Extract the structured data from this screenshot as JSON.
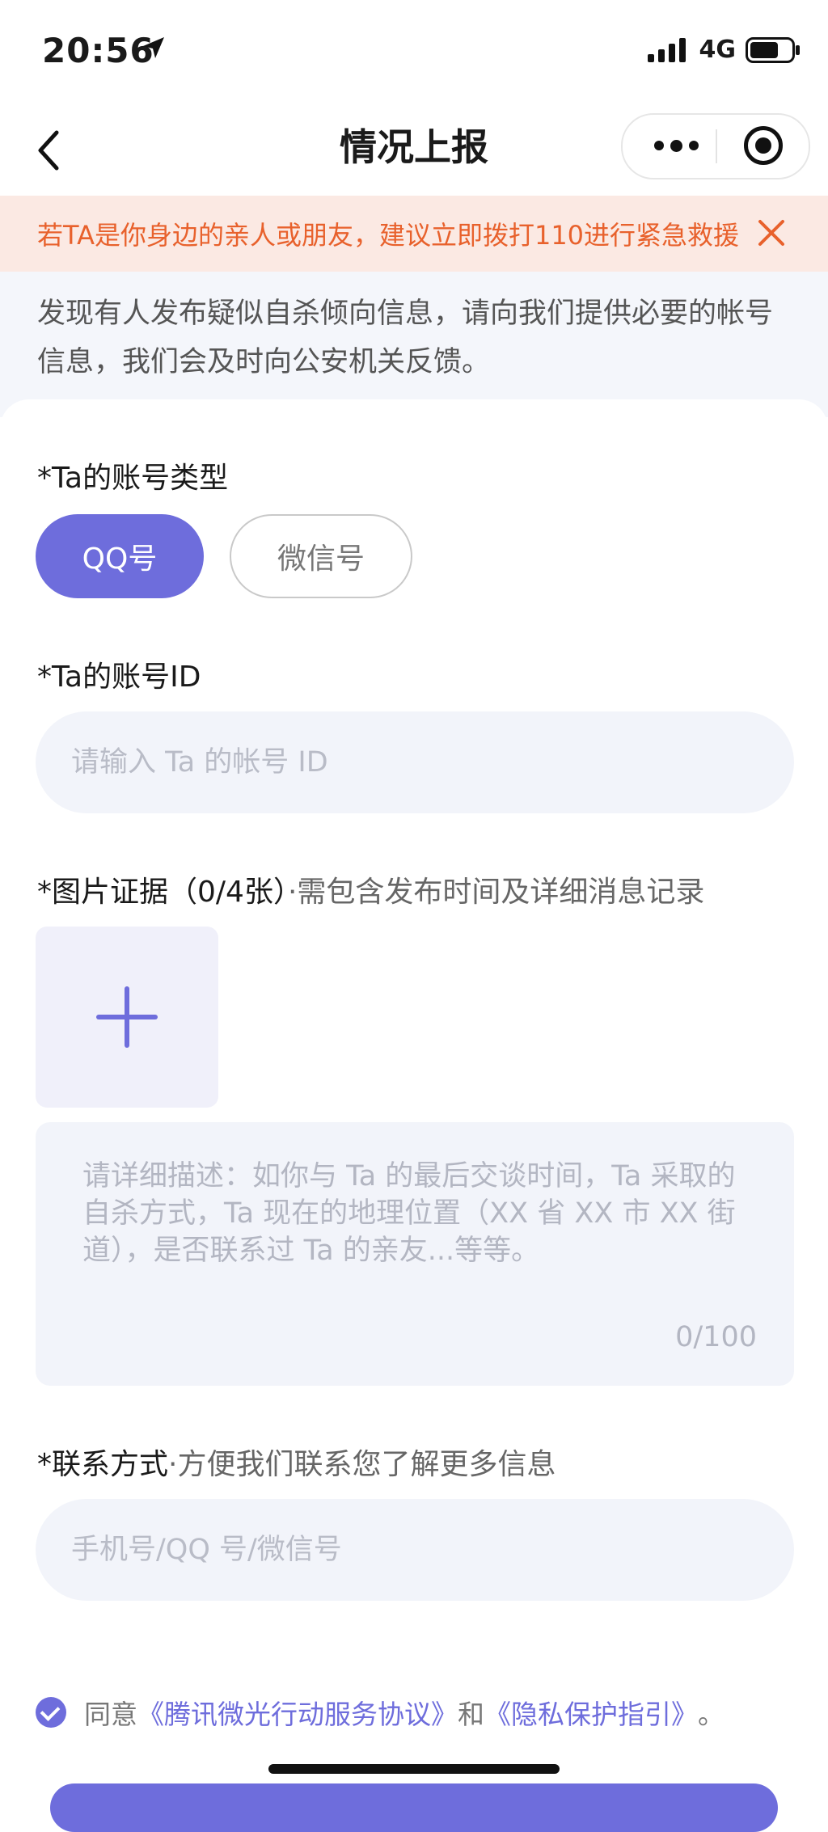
{
  "status_bar": {
    "time": "20:56",
    "network": "4G"
  },
  "nav": {
    "title": "情况上报"
  },
  "warning": {
    "text": "若TA是你身边的亲人或朋友，建议立即拨打110进行紧急救援"
  },
  "intro": {
    "text": "发现有人发布疑似自杀倾向信息，请向我们提供必要的帐号信息，我们会及时向公安机关反馈。"
  },
  "form": {
    "account_type_label": "*Ta的账号类型",
    "account_types": [
      "QQ号",
      "微信号"
    ],
    "selected_account_type": "QQ号",
    "account_id_label": "*Ta的账号ID",
    "account_id_placeholder": "请输入 Ta 的帐号 ID",
    "account_id_value": "",
    "evidence_label": "*图片证据（0/4张）",
    "evidence_hint": "·需包含发布时间及详细消息记录",
    "description_placeholder": "请详细描述：如你与 Ta 的最后交谈时间，Ta 采取的自杀方式，Ta 现在的地理位置（XX 省 XX 市 XX 街道），是否联系过 Ta 的亲友...等等。",
    "description_count": "0/100",
    "contact_label": "*联系方式",
    "contact_hint": "·方便我们联系您了解更多信息",
    "contact_placeholder": "手机号/QQ 号/微信号",
    "contact_value": ""
  },
  "agreement": {
    "prefix": "同意",
    "link1": "《腾讯微光行动服务协议》",
    "middle": "和",
    "link2": "《隐私保护指引》",
    "suffix": "。",
    "checked": true
  },
  "colors": {
    "accent": "#6e6ddc",
    "warning_text": "#e8612c",
    "warning_bg": "#fbe9e3",
    "page_bg": "#f4f6fb"
  }
}
